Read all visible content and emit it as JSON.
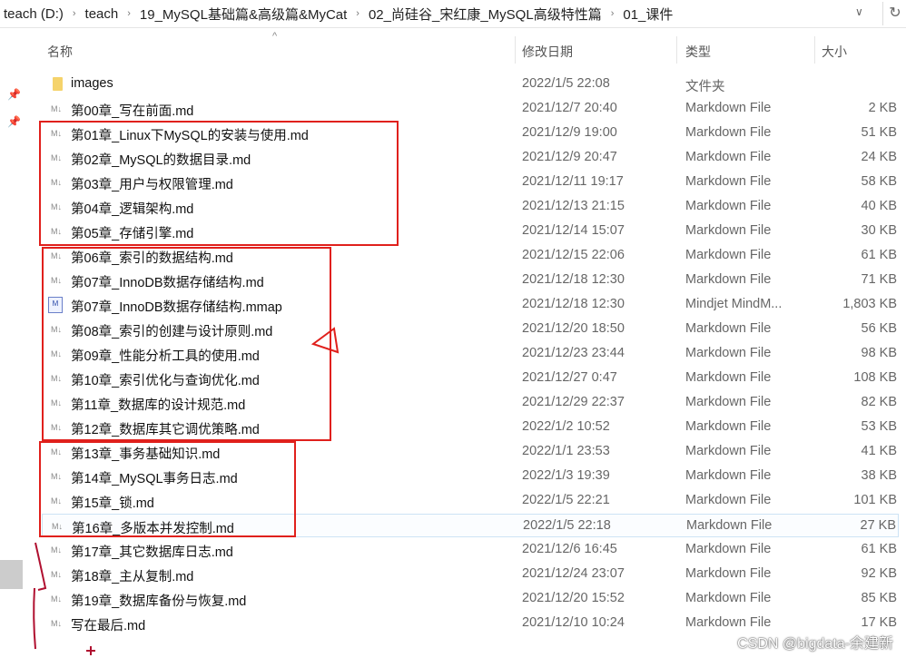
{
  "breadcrumb": [
    "teach (D:)",
    "teach",
    "19_MySQL基础篇&高级篇&MyCat",
    "02_尚硅谷_宋红康_MySQL高级特性篇",
    "01_课件"
  ],
  "columns": {
    "name": "名称",
    "date": "修改日期",
    "type": "类型",
    "size": "大小"
  },
  "files": [
    {
      "name": "images",
      "date": "2022/1/5 22:08",
      "type": "文件夹",
      "size": "",
      "icon": "folder-icon"
    },
    {
      "name": "第00章_写在前面.md",
      "date": "2021/12/7 20:40",
      "type": "Markdown File",
      "size": "2 KB",
      "icon": "markdown-icon"
    },
    {
      "name": "第01章_Linux下MySQL的安装与使用.md",
      "date": "2021/12/9 19:00",
      "type": "Markdown File",
      "size": "51 KB",
      "icon": "markdown-icon"
    },
    {
      "name": "第02章_MySQL的数据目录.md",
      "date": "2021/12/9 20:47",
      "type": "Markdown File",
      "size": "24 KB",
      "icon": "markdown-icon"
    },
    {
      "name": "第03章_用户与权限管理.md",
      "date": "2021/12/11 19:17",
      "type": "Markdown File",
      "size": "58 KB",
      "icon": "markdown-icon"
    },
    {
      "name": "第04章_逻辑架构.md",
      "date": "2021/12/13 21:15",
      "type": "Markdown File",
      "size": "40 KB",
      "icon": "markdown-icon"
    },
    {
      "name": "第05章_存储引擎.md",
      "date": "2021/12/14 15:07",
      "type": "Markdown File",
      "size": "30 KB",
      "icon": "markdown-icon"
    },
    {
      "name": "第06章_索引的数据结构.md",
      "date": "2021/12/15 22:06",
      "type": "Markdown File",
      "size": "61 KB",
      "icon": "markdown-icon"
    },
    {
      "name": "第07章_InnoDB数据存储结构.md",
      "date": "2021/12/18 12:30",
      "type": "Markdown File",
      "size": "71 KB",
      "icon": "markdown-icon"
    },
    {
      "name": "第07章_InnoDB数据存储结构.mmap",
      "date": "2021/12/18 12:30",
      "type": "Mindjet MindM...",
      "size": "1,803 KB",
      "icon": "mindmap-icon"
    },
    {
      "name": "第08章_索引的创建与设计原则.md",
      "date": "2021/12/20 18:50",
      "type": "Markdown File",
      "size": "56 KB",
      "icon": "markdown-icon"
    },
    {
      "name": "第09章_性能分析工具的使用.md",
      "date": "2021/12/23 23:44",
      "type": "Markdown File",
      "size": "98 KB",
      "icon": "markdown-icon"
    },
    {
      "name": "第10章_索引优化与查询优化.md",
      "date": "2021/12/27 0:47",
      "type": "Markdown File",
      "size": "108 KB",
      "icon": "markdown-icon"
    },
    {
      "name": "第11章_数据库的设计规范.md",
      "date": "2021/12/29 22:37",
      "type": "Markdown File",
      "size": "82 KB",
      "icon": "markdown-icon"
    },
    {
      "name": "第12章_数据库其它调优策略.md",
      "date": "2022/1/2 10:52",
      "type": "Markdown File",
      "size": "53 KB",
      "icon": "markdown-icon"
    },
    {
      "name": "第13章_事务基础知识.md",
      "date": "2022/1/1 23:53",
      "type": "Markdown File",
      "size": "41 KB",
      "icon": "markdown-icon"
    },
    {
      "name": "第14章_MySQL事务日志.md",
      "date": "2022/1/3 19:39",
      "type": "Markdown File",
      "size": "38 KB",
      "icon": "markdown-icon"
    },
    {
      "name": "第15章_锁.md",
      "date": "2022/1/5 22:21",
      "type": "Markdown File",
      "size": "101 KB",
      "icon": "markdown-icon"
    },
    {
      "name": "第16章_多版本并发控制.md",
      "date": "2022/1/5 22:18",
      "type": "Markdown File",
      "size": "27 KB",
      "icon": "markdown-icon",
      "hovered": true
    },
    {
      "name": "第17章_其它数据库日志.md",
      "date": "2021/12/6 16:45",
      "type": "Markdown File",
      "size": "61 KB",
      "icon": "markdown-icon"
    },
    {
      "name": "第18章_主从复制.md",
      "date": "2021/12/24 23:07",
      "type": "Markdown File",
      "size": "92 KB",
      "icon": "markdown-icon"
    },
    {
      "name": "第19章_数据库备份与恢复.md",
      "date": "2021/12/20 15:52",
      "type": "Markdown File",
      "size": "85 KB",
      "icon": "markdown-icon"
    },
    {
      "name": "写在最后.md",
      "date": "2021/12/10 10:24",
      "type": "Markdown File",
      "size": "17 KB",
      "icon": "markdown-icon"
    }
  ],
  "watermark": "CSDN @bigdata-余建新",
  "annotation_color": "#e0201c"
}
